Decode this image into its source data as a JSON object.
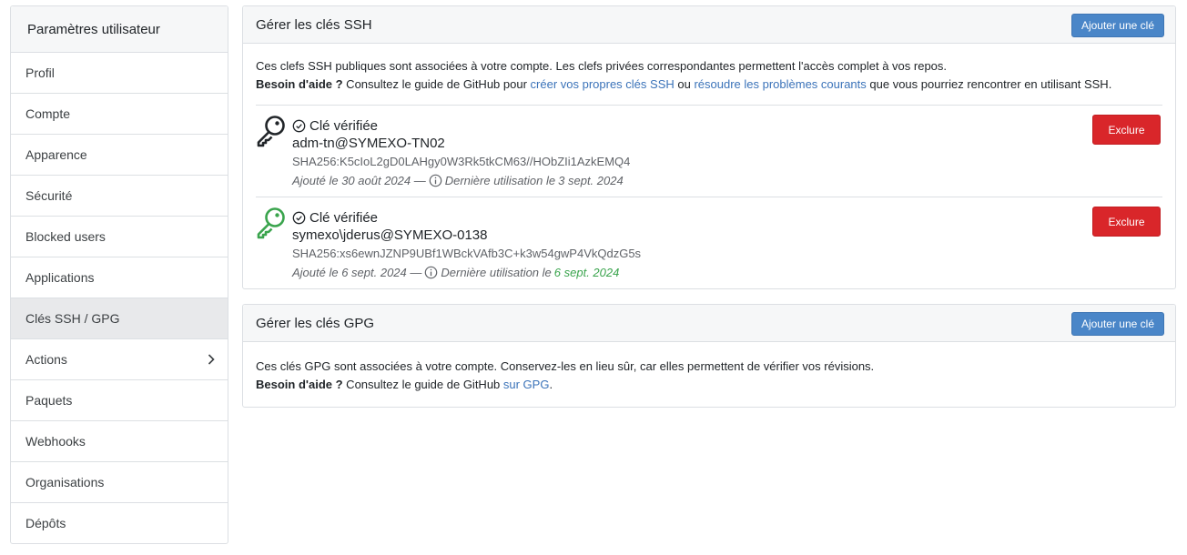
{
  "sidebar": {
    "title": "Paramètres utilisateur",
    "items": [
      {
        "label": "Profil"
      },
      {
        "label": "Compte"
      },
      {
        "label": "Apparence"
      },
      {
        "label": "Sécurité"
      },
      {
        "label": "Blocked users"
      },
      {
        "label": "Applications"
      },
      {
        "label": "Clés SSH / GPG",
        "active": true
      },
      {
        "label": "Actions",
        "icon": "chevron-right-icon"
      },
      {
        "label": "Paquets"
      },
      {
        "label": "Webhooks"
      },
      {
        "label": "Organisations"
      },
      {
        "label": "Dépôts"
      }
    ]
  },
  "ssh": {
    "title": "Gérer les clés SSH",
    "add_button": "Ajouter une clé",
    "desc_line1": "Ces clefs SSH publiques sont associées à votre compte. Les clefs privées correspondantes permettent l'accès complet à vos repos.",
    "help_bold": "Besoin d'aide ?",
    "help_text1": " Consultez le guide de GitHub pour ",
    "help_link1": "créer vos propres clés SSH",
    "help_text2": " ou ",
    "help_link2": "résoudre les problèmes courants",
    "help_text3": " que vous pourriez rencontrer en utilisant SSH.",
    "keys": [
      {
        "verified_label": "Clé vérifiée",
        "name": "adm-tn@SYMEXO-TN02",
        "fingerprint": "SHA256:K5cIoL2gD0LAHgy0W3Rk5tkCM63//HObZIi1AzkEMQ4",
        "added": "Ajouté le 30 août 2024 —",
        "last_used_label": "Dernière utilisation le",
        "last_used_date": "3 sept. 2024",
        "delete_label": "Exclure",
        "icon": "key-icon",
        "icon_color": "#212529",
        "recent": false
      },
      {
        "verified_label": "Clé vérifiée",
        "name": "symexo\\jderus@SYMEXO-0138",
        "fingerprint": "SHA256:xs6ewnJZNP9UBf1WBckVAfb3C+k3w54gwP4VkQdzG5s",
        "added": "Ajouté le 6 sept. 2024 —",
        "last_used_label": "Dernière utilisation le",
        "last_used_date": "6 sept. 2024",
        "delete_label": "Exclure",
        "icon": "key-icon",
        "icon_color": "#3aa44d",
        "recent": true
      }
    ]
  },
  "gpg": {
    "title": "Gérer les clés GPG",
    "add_button": "Ajouter une clé",
    "desc_line1": "Ces clés GPG sont associées à votre compte. Conservez-les en lieu sûr, car elles permettent de vérifier vos révisions.",
    "help_bold": "Besoin d'aide ?",
    "help_text1": " Consultez le guide de GitHub ",
    "help_link1": "sur GPG",
    "help_text2": "."
  },
  "colors": {
    "accent": "#4a86c8",
    "danger": "#d9262a",
    "link": "#3b73b9",
    "success": "#3aa44d"
  }
}
